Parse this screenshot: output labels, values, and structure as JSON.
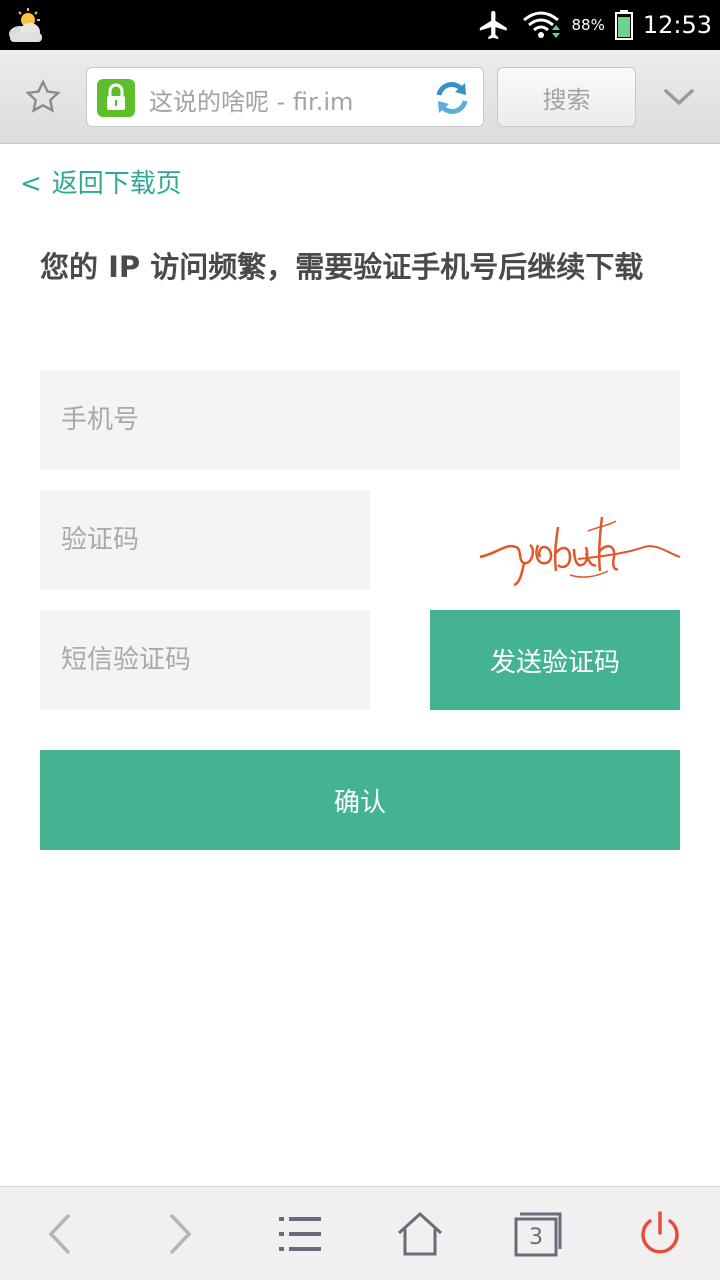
{
  "status_bar": {
    "battery_percent": "88%",
    "time": "12:53",
    "icons": [
      "weather-icon",
      "airplane-icon",
      "wifi-icon",
      "battery-icon"
    ]
  },
  "browser": {
    "url_title": "这说的啥呢 - fir.im",
    "search_label": "搜索",
    "icons": [
      "star-icon",
      "lock-icon",
      "reload-icon",
      "chevron-down-icon"
    ]
  },
  "page": {
    "back_arrow": "<",
    "back_label": "返回下载页",
    "heading": "您的 IP 访问频繁，需要验证手机号后继续下载",
    "phone_placeholder": "手机号",
    "captcha_placeholder": "验证码",
    "sms_placeholder": "短信验证码",
    "send_code_label": "发送验证码",
    "confirm_label": "确认"
  },
  "bottom_nav": {
    "tab_count": "3",
    "icons": [
      "back-arrow-icon",
      "forward-arrow-icon",
      "menu-list-icon",
      "home-icon",
      "tabs-icon",
      "power-icon"
    ]
  },
  "colors": {
    "accent": "#44b393",
    "link": "#2fa896",
    "field_bg": "#f4f4f4",
    "power_red": "#e84c3d",
    "lock_green": "#5cbf2a"
  }
}
